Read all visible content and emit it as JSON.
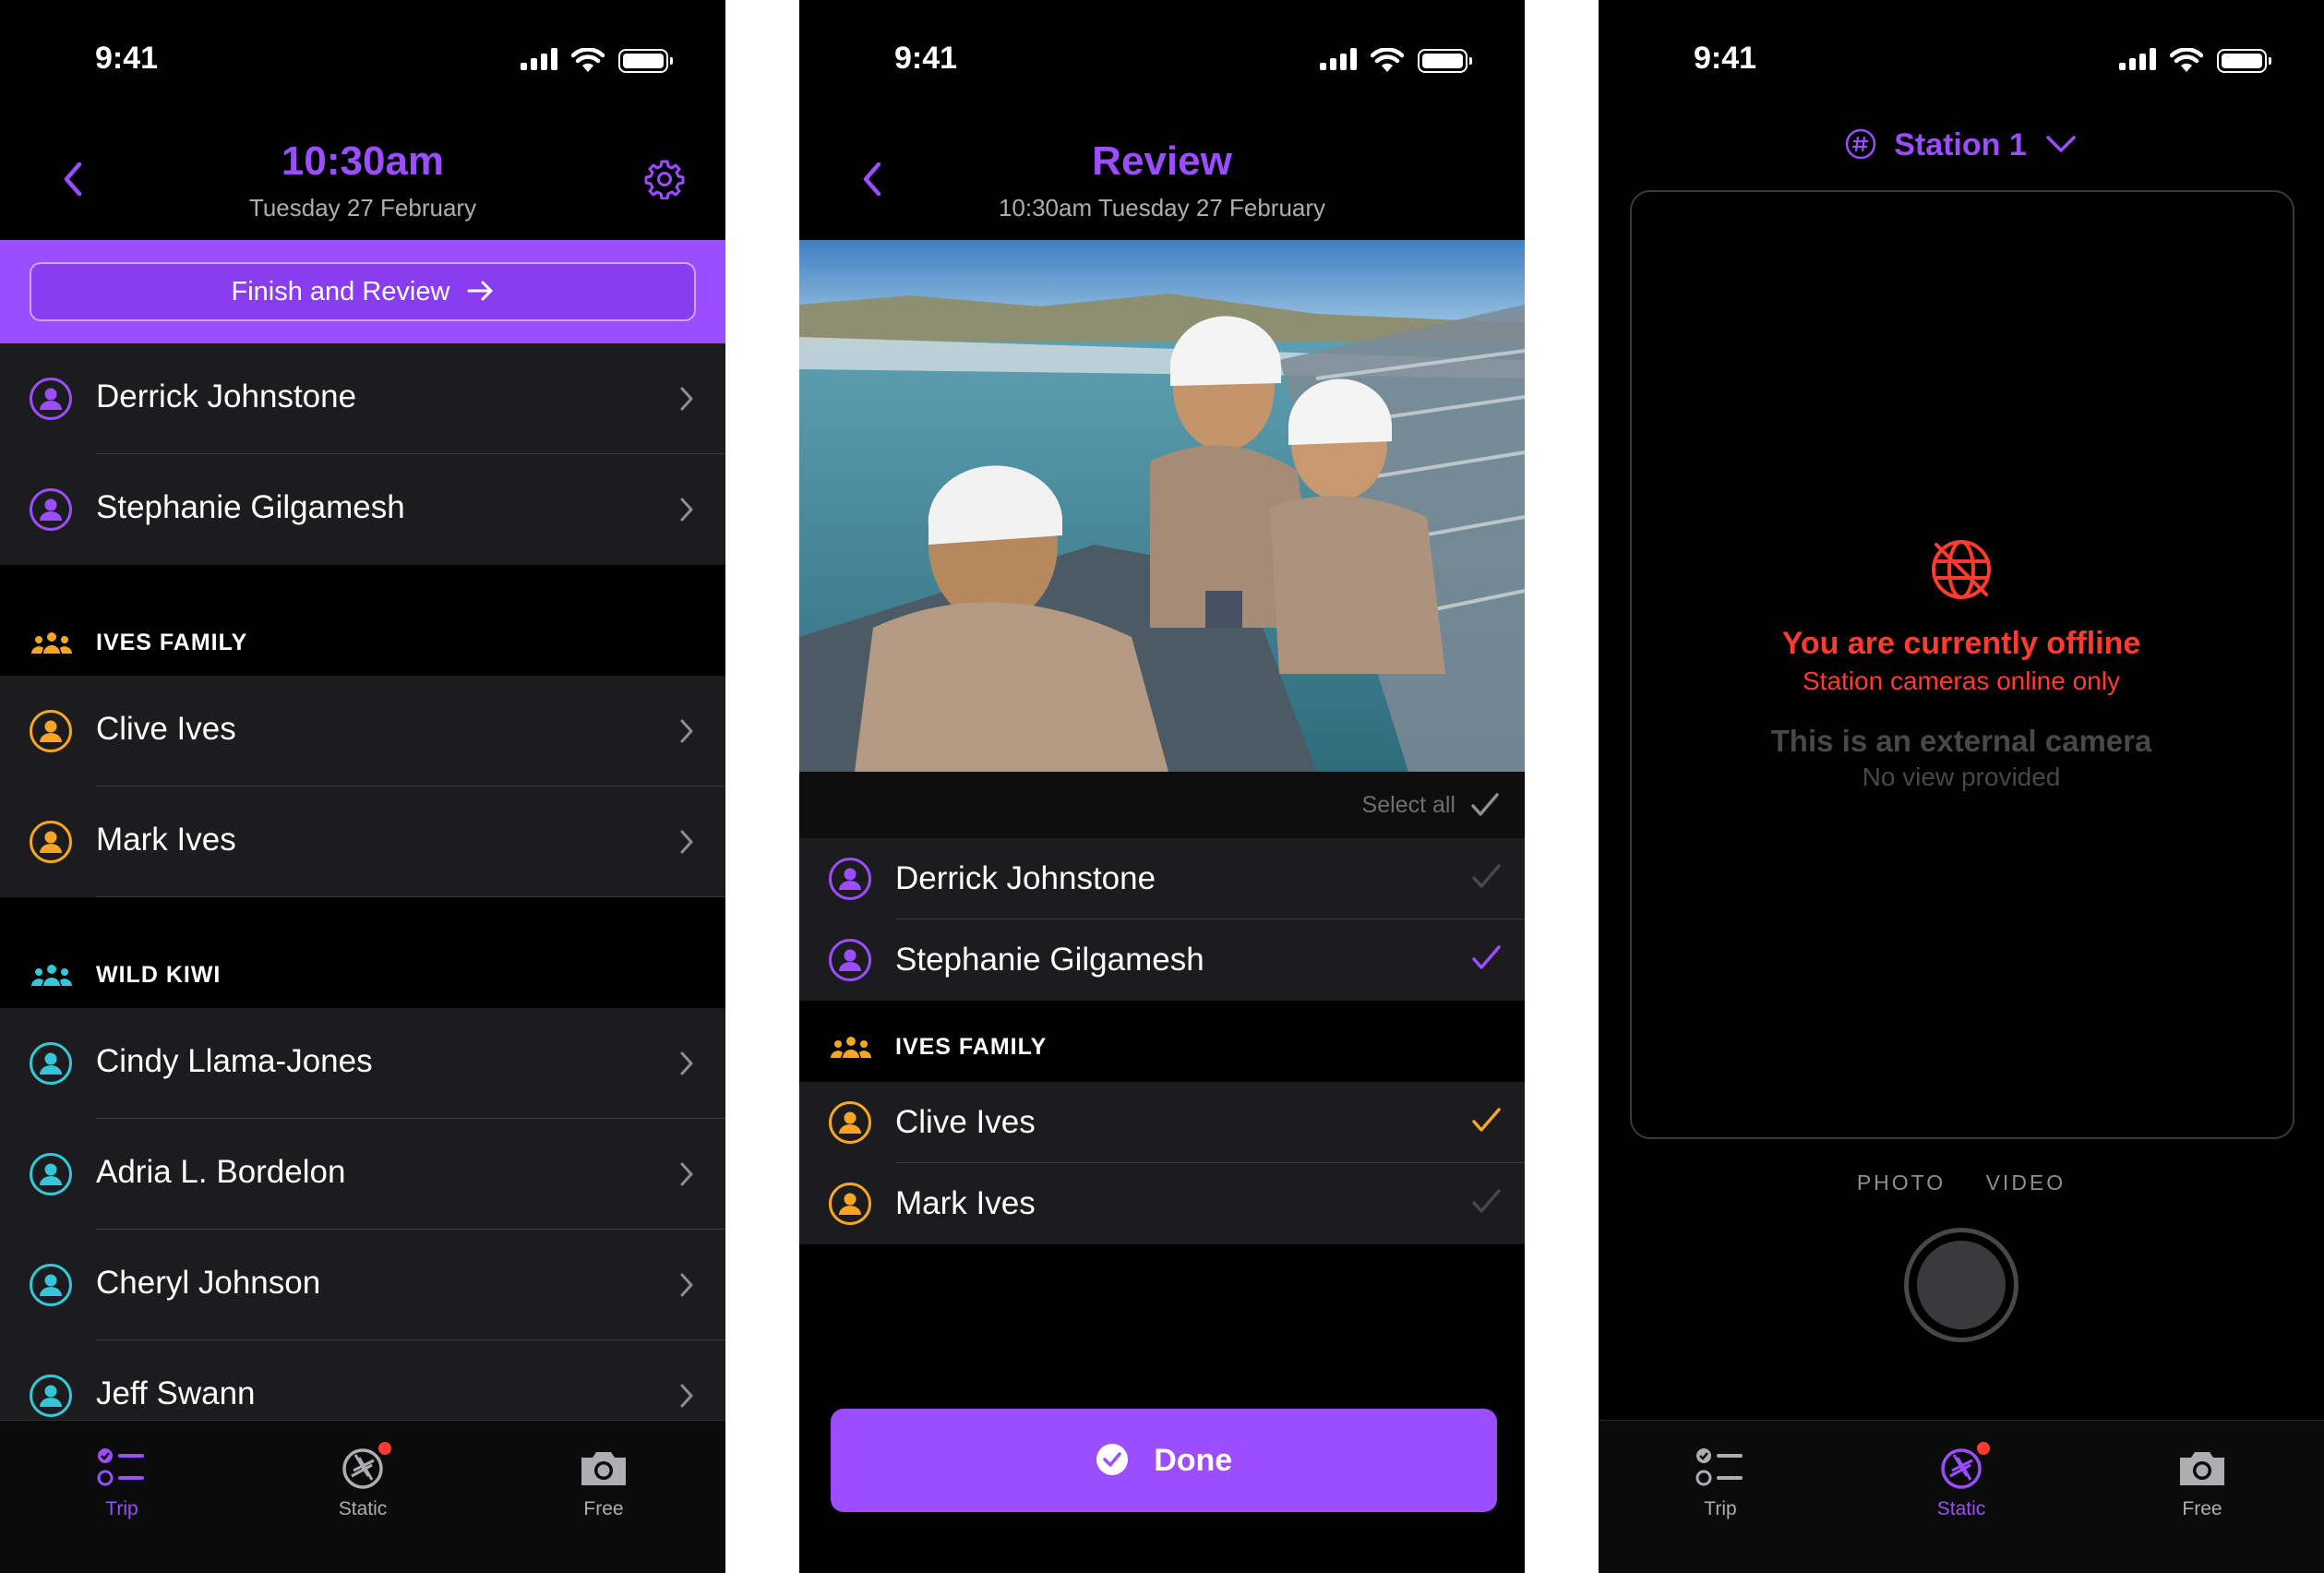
{
  "status_time": "9:41",
  "colors": {
    "accent": "#9b4dff",
    "orange": "#f5a623",
    "cyan": "#35c7d9",
    "red": "#ff3b30"
  },
  "screen1": {
    "title": "10:30am",
    "subtitle": "Tuesday 27 February",
    "finish_button": "Finish and Review",
    "individuals": [
      {
        "name": "Derrick Johnstone"
      },
      {
        "name": "Stephanie Gilgamesh"
      }
    ],
    "groups": [
      {
        "title": "IVES FAMILY",
        "members": [
          {
            "name": "Clive Ives"
          },
          {
            "name": "Mark Ives"
          }
        ]
      },
      {
        "title": "WILD KIWI",
        "members": [
          {
            "name": "Cindy Llama-Jones"
          },
          {
            "name": "Adria L. Bordelon"
          },
          {
            "name": "Cheryl Johnson"
          },
          {
            "name": "Jeff Swann"
          }
        ]
      }
    ]
  },
  "screen2": {
    "title": "Review",
    "subtitle": "10:30am Tuesday 27 February",
    "select_all": "Select all",
    "people": [
      {
        "name": "Derrick Johnstone",
        "checked": false
      },
      {
        "name": "Stephanie Gilgamesh",
        "checked": true
      }
    ],
    "group": {
      "title": "IVES FAMILY",
      "members": [
        {
          "name": "Clive Ives",
          "checked": true
        },
        {
          "name": "Mark Ives",
          "checked": false
        }
      ]
    },
    "done_button": "Done"
  },
  "screen3": {
    "station": "Station 1",
    "offline_title": "You are currently offline",
    "offline_sub": "Station cameras online only",
    "external_title": "This is an external camera",
    "external_sub": "No view provided",
    "mode_photo": "PHOTO",
    "mode_video": "VIDEO"
  },
  "tabs": [
    {
      "label": "Trip",
      "icon": "checklist-icon"
    },
    {
      "label": "Static",
      "icon": "aperture-icon"
    },
    {
      "label": "Free",
      "icon": "camera-icon"
    }
  ],
  "tabbar_screen1": {
    "active": "Trip"
  },
  "tabbar_screen3": {
    "active": "Static"
  }
}
